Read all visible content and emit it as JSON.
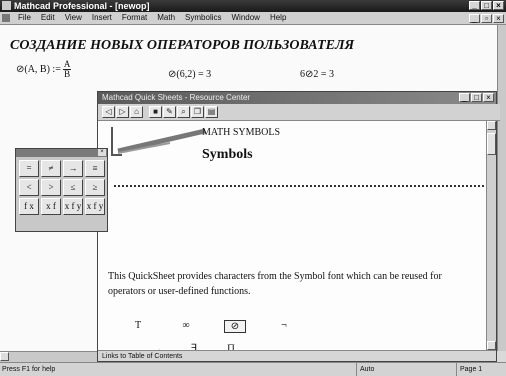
{
  "window": {
    "title": "Mathcad Professional - [newop]"
  },
  "menu": [
    "File",
    "Edit",
    "View",
    "Insert",
    "Format",
    "Math",
    "Symbolics",
    "Window",
    "Help"
  ],
  "worksheet": {
    "heading": "СОЗДАНИЕ НОВЫХ ОПЕРАТОРОВ ПОЛЬЗОВАТЕЛЯ",
    "definition_lhs": "⊘(A, B) :=",
    "definition_num": "A",
    "definition_den": "B",
    "eval1": "⊘(6,2) = 3",
    "eval2": "6⊘2 = 3"
  },
  "quicksheet": {
    "title": "Mathcad Quick Sheets - Resource Center",
    "toolbar_icons": [
      "back-icon",
      "forward-icon",
      "home-icon",
      "stop-icon",
      "annotate-icon",
      "find-icon",
      "copy-icon",
      "print-icon"
    ],
    "section_title": "MATH SYMBOLS",
    "page_title": "Symbols",
    "description": "This QuickSheet provides characters from the Symbol font which can be reused for operators or user-defined functions.",
    "symbols_row1": [
      "T",
      "∞",
      "⊘",
      "¬"
    ],
    "symbols_row2": [
      ".",
      "∃",
      "∏"
    ],
    "status": "Links to Table of Contents"
  },
  "palette": {
    "buttons": [
      "=",
      "≠",
      "→",
      "≡",
      "<",
      ">",
      "≤",
      "≥",
      "f x",
      "x f",
      "x f y",
      "x f y"
    ]
  },
  "statusbar": {
    "help": "Press F1 for help",
    "mode": "Auto",
    "page": "Page 1"
  }
}
